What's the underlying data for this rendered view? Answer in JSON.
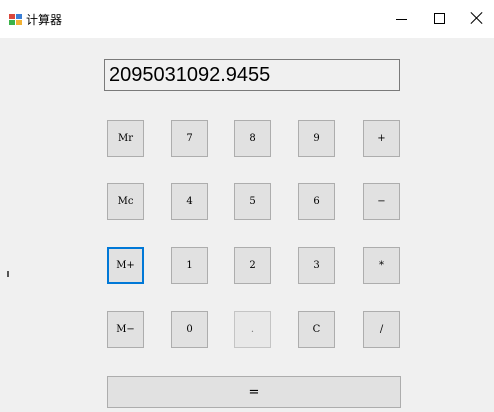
{
  "window": {
    "title": "计算器",
    "controls": {
      "minimize": "—",
      "maximize": "☐",
      "close": "✕"
    }
  },
  "display": {
    "value": "2095031092.9455"
  },
  "keypad": {
    "rows": [
      [
        "Mr",
        "7",
        "8",
        "9",
        "+"
      ],
      [
        "Mc",
        "4",
        "5",
        "6",
        "−"
      ],
      [
        "M+",
        "1",
        "2",
        "3",
        "*"
      ],
      [
        "M−",
        "0",
        ".",
        "C",
        "/"
      ]
    ],
    "equals": "="
  },
  "colors": {
    "focus_border": "#0078d7",
    "window_bg": "#f0f0f0",
    "button_bg": "#e1e1e1"
  }
}
